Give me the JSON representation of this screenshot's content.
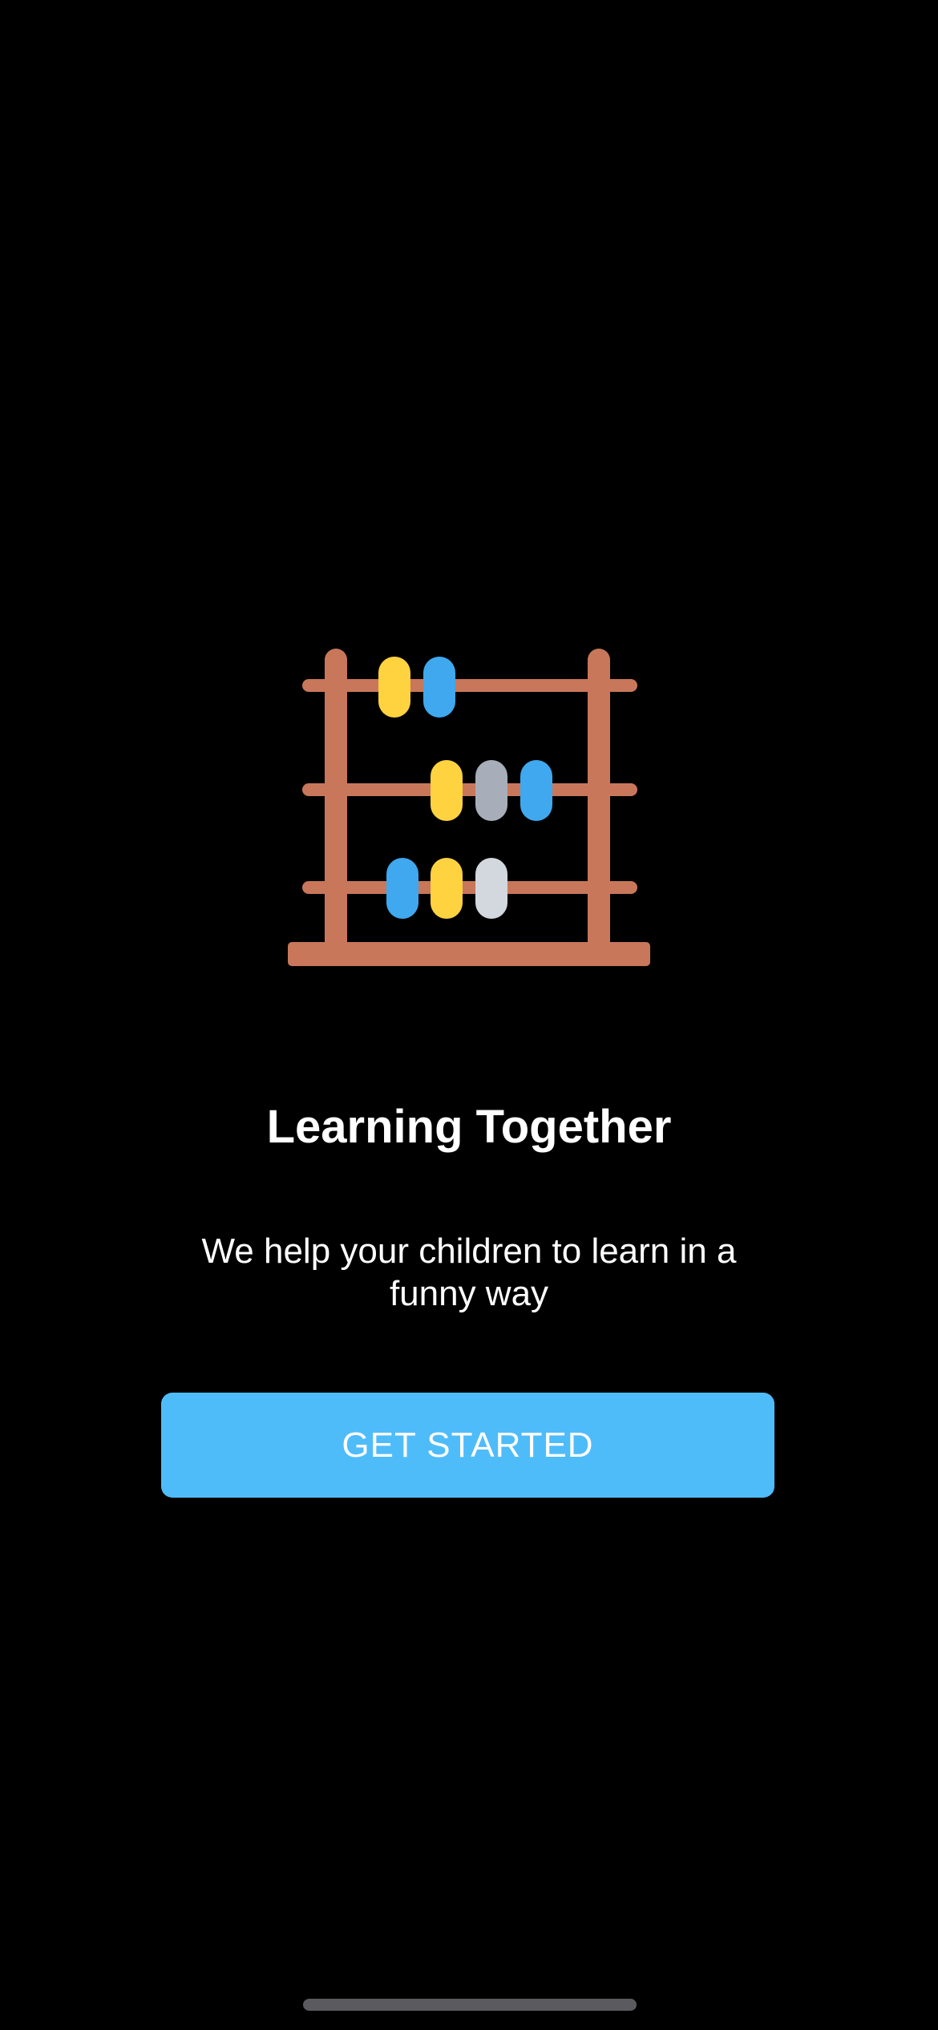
{
  "onboarding": {
    "illustration_icon": "abacus-icon",
    "title": "Learning Together",
    "subtitle": "We help your children to learn in a funny way",
    "cta_label": "GET STARTED"
  },
  "colors": {
    "background": "#000000",
    "button": "#4FBCFA",
    "abacus_frame": "#C8775A",
    "bead_yellow": "#FFD23F",
    "bead_blue": "#3FA8EE",
    "bead_gray": "#A7AEBA",
    "bead_light": "#D3D7DE",
    "home_indicator": "#5B5B5F"
  }
}
